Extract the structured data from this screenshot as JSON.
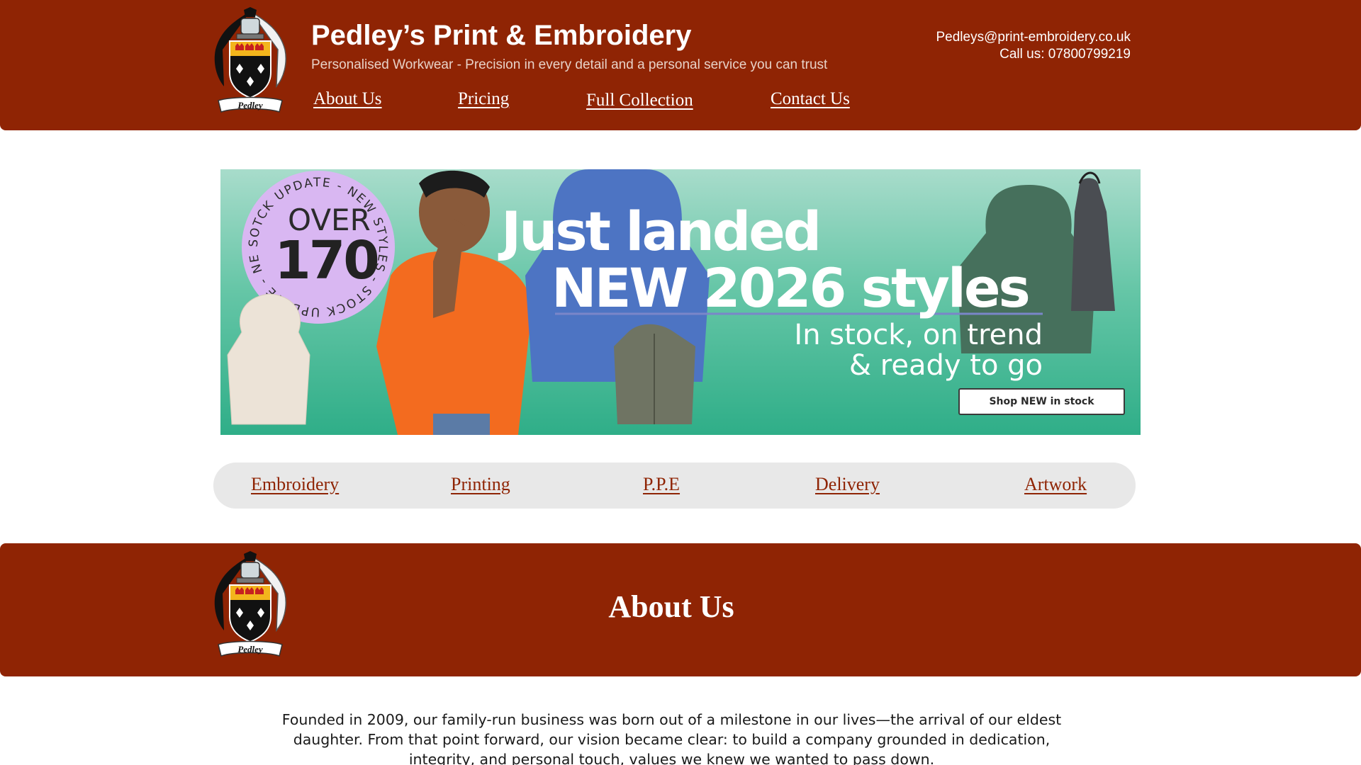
{
  "header": {
    "title": "Pedley’s Print & Embroidery",
    "tagline": "Personalised Workwear - Precision in every detail and a personal service you can trust",
    "email": "Pedleys@print-embroidery.co.uk",
    "phone": "Call us: 07800799219",
    "logo_text": "Pedley",
    "nav": [
      "About Us",
      "Pricing",
      "Full Collection",
      "Contact Us"
    ]
  },
  "banner": {
    "badge_ring": "SOTCK UPDATE - NEW STYLES - STOCK UPDATE - NEW STYLES -",
    "badge_over": "OVER",
    "badge_number": "170",
    "headline_line1": "Just landed",
    "headline_line2": "NEW 2026 styles",
    "sub_line1": "In stock, on trend",
    "sub_line2": "& ready to go",
    "button": "Shop NEW in stock"
  },
  "services": [
    "Embroidery",
    "Printing",
    "P.P.E",
    "Delivery",
    "Artwork"
  ],
  "about": {
    "title": "About Us",
    "logo_text": "Pedley",
    "paragraph": "Founded in 2009, our family-run business was born out of a milestone in our lives—the arrival of our eldest daughter. From that point forward, our vision became clear: to build a company grounded in dedication, integrity, and personal touch, values we knew we wanted to pass down."
  },
  "colors": {
    "brand": "#8f2404",
    "service_bar": "#e8e8e8",
    "banner_green": "#2fae88",
    "badge_lilac": "#d9b7f2"
  }
}
